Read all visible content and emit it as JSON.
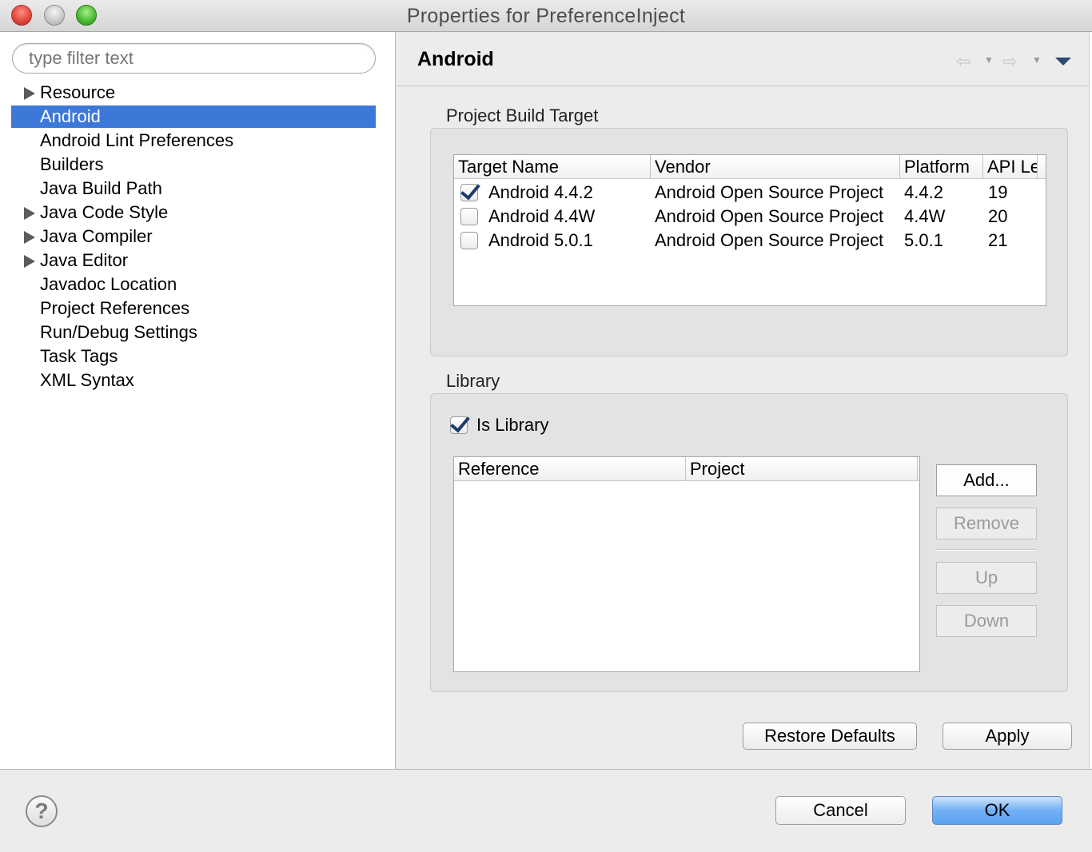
{
  "window": {
    "title": "Properties for PreferenceInject"
  },
  "filter": {
    "placeholder": "type filter text"
  },
  "tree": [
    {
      "label": "Resource",
      "expandable": true
    },
    {
      "label": "Android",
      "expandable": false,
      "selected": true
    },
    {
      "label": "Android Lint Preferences",
      "expandable": false
    },
    {
      "label": "Builders",
      "expandable": false
    },
    {
      "label": "Java Build Path",
      "expandable": false
    },
    {
      "label": "Java Code Style",
      "expandable": true
    },
    {
      "label": "Java Compiler",
      "expandable": true
    },
    {
      "label": "Java Editor",
      "expandable": true
    },
    {
      "label": "Javadoc Location",
      "expandable": false
    },
    {
      "label": "Project References",
      "expandable": false
    },
    {
      "label": "Run/Debug Settings",
      "expandable": false
    },
    {
      "label": "Task Tags",
      "expandable": false
    },
    {
      "label": "XML Syntax",
      "expandable": false
    }
  ],
  "page": {
    "title": "Android"
  },
  "build_target": {
    "label": "Project Build Target",
    "columns": [
      "Target Name",
      "Vendor",
      "Platform",
      "API Le"
    ],
    "rows": [
      {
        "checked": true,
        "name": "Android 4.4.2",
        "vendor": "Android Open Source Project",
        "platform": "4.4.2",
        "api": "19"
      },
      {
        "checked": false,
        "name": "Android 4.4W",
        "vendor": "Android Open Source Project",
        "platform": "4.4W",
        "api": "20"
      },
      {
        "checked": false,
        "name": "Android 5.0.1",
        "vendor": "Android Open Source Project",
        "platform": "5.0.1",
        "api": "21"
      }
    ]
  },
  "library": {
    "label": "Library",
    "is_library_label": "Is Library",
    "is_library_checked": true,
    "columns": [
      "Reference",
      "Project"
    ],
    "buttons": {
      "add": "Add...",
      "remove": "Remove",
      "up": "Up",
      "down": "Down"
    }
  },
  "actions": {
    "restore_defaults": "Restore Defaults",
    "apply": "Apply"
  },
  "dialog": {
    "cancel": "Cancel",
    "ok": "OK",
    "help": "?"
  },
  "colors": {
    "selection": "#3b78d8",
    "primary_button": "#72b0f5"
  }
}
